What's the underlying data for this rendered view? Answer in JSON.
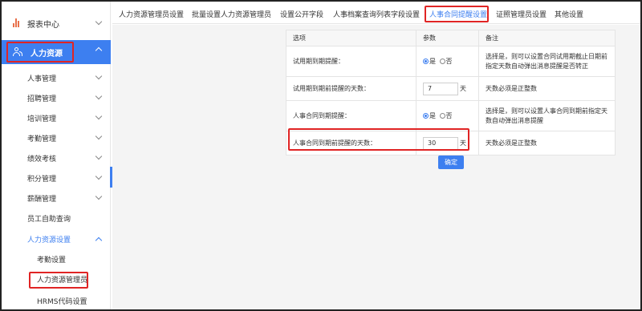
{
  "sidebar": {
    "report_center": "报表中心",
    "hr_section": "人力资源",
    "items": [
      "人事管理",
      "招聘管理",
      "培训管理",
      "考勤管理",
      "绩效考核",
      "积分管理",
      "薪酬管理",
      "员工自助查询"
    ],
    "hr_settings": "人力资源设置",
    "sub_items": [
      "考勤设置",
      "人力资源管理员",
      "HRMS代码设置"
    ]
  },
  "tabs": [
    "人力资源管理员设置",
    "批量设置人力资源管理员",
    "设置公开字段",
    "人事档案查询列表字段设置",
    "人事合同提醒设置",
    "证照管理员设置",
    "其他设置"
  ],
  "active_tab": "人事合同提醒设置",
  "table": {
    "headers": [
      "选项",
      "参数",
      "备注"
    ],
    "rows": [
      {
        "option": "试用期到期提醒：",
        "yes": "是",
        "no": "否",
        "note": "选择是，则可以设置合同试用期截止日期前指定天数自动弹出消息提醒是否转正"
      },
      {
        "option": "试用期到期前提醒的天数：",
        "value": "7",
        "unit": "天",
        "note": "天数必须是正整数"
      },
      {
        "option": "人事合同到期提醒：",
        "yes": "是",
        "no": "否",
        "note": "选择是，则可以设置人事合同到期前指定天数自动弹出消息提醒"
      },
      {
        "option": "人事合同到期前提醒的天数：",
        "value": "30",
        "unit": "天",
        "note": "天数必须是正整数"
      }
    ]
  },
  "confirm_button": "确定",
  "colors": {
    "accent": "#3d7ff0",
    "highlight": "#e02424"
  }
}
